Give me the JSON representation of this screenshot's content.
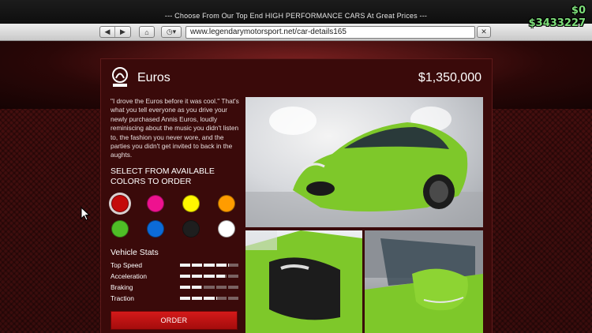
{
  "browser": {
    "title": "--- Choose From Our Top End HIGH PERFORMANCE CARS At Great Prices ---",
    "back_icon": "◀",
    "forward_icon": "▶",
    "home_icon": "⌂",
    "history_icon": "◷▾",
    "url": "www.legendarymotorsport.net/car-details165",
    "stop_icon": "✕"
  },
  "hud": {
    "cash": "$0",
    "bank": "$3433227"
  },
  "product": {
    "name": "Euros",
    "price": "$1,350,000",
    "brand_logo": "annis-logo",
    "description": "\"I drove the Euros before it was cool.\" That's what you tell everyone as you drive your newly purchased Annis Euros, loudly reminiscing about the music you didn't listen to, the fashion you never wore, and the parties you didn't get invited to back in the aughts."
  },
  "colors": {
    "heading_line1": "SELECT FROM AVAILABLE",
    "heading_line2": "COLORS TO ORDER",
    "swatches": [
      {
        "name": "red",
        "hex": "#c40b0b",
        "selected": true
      },
      {
        "name": "magenta",
        "hex": "#ee128f",
        "selected": false
      },
      {
        "name": "yellow",
        "hex": "#fff600",
        "selected": false
      },
      {
        "name": "orange",
        "hex": "#ff9c00",
        "selected": false
      },
      {
        "name": "green",
        "hex": "#4fbe26",
        "selected": false
      },
      {
        "name": "blue",
        "hex": "#0c6bd8",
        "selected": false
      },
      {
        "name": "black",
        "hex": "#1e1e1e",
        "selected": false
      },
      {
        "name": "white",
        "hex": "#ffffff",
        "selected": false
      }
    ]
  },
  "stats": {
    "heading": "Vehicle Stats",
    "items": [
      {
        "label": "Top Speed",
        "value": 0.82
      },
      {
        "label": "Acceleration",
        "value": 0.78
      },
      {
        "label": "Braking",
        "value": 0.38
      },
      {
        "label": "Traction",
        "value": 0.62
      }
    ]
  },
  "order": {
    "label": "ORDER"
  },
  "photos": {
    "body_color": "#7ec82a"
  }
}
